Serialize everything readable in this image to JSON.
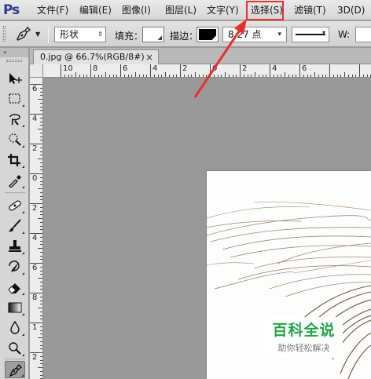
{
  "app": {
    "logo_text": "Ps",
    "menu": [
      {
        "label": "文件(F)"
      },
      {
        "label": "编辑(E)"
      },
      {
        "label": "图像(I)"
      },
      {
        "label": "图层(L)"
      },
      {
        "label": "文字(Y)"
      },
      {
        "label": "选择(S)"
      },
      {
        "label": "滤镜(T)"
      },
      {
        "label": "3D(D)"
      }
    ],
    "highlighted_menu": "选择(S)",
    "highlight_color": "#e53030"
  },
  "options_bar": {
    "tool_icon": "pen-icon",
    "mode_value": "形状",
    "fill_label": "填充：",
    "fill_color": "#ffffff",
    "stroke_label": "描边：",
    "stroke_color": "#000000",
    "stroke_width_value": "8.27 点",
    "stroke_style": "solid-line",
    "width_label": "W:"
  },
  "document": {
    "tab_title": "0.jpg @ 66.7%(RGB/8#)",
    "close_glyph": "×",
    "background_color": "#999999"
  },
  "rulers": {
    "horizontal_labels": [
      "10",
      "8",
      "6",
      "4",
      "2",
      "0",
      "2",
      "4",
      "6"
    ],
    "vertical_labels": [
      "6",
      "4",
      "2",
      "0",
      "2",
      "4",
      "6",
      "8",
      "1",
      "2"
    ]
  },
  "toolbar": {
    "collapse_glyph": "»",
    "tools": [
      {
        "name": "move-icon"
      },
      {
        "name": "marquee-icon"
      },
      {
        "name": "lasso-icon"
      },
      {
        "name": "quick-selection-icon"
      },
      {
        "name": "crop-icon"
      },
      {
        "name": "eyedropper-icon"
      },
      {
        "name": "healing-brush-icon"
      },
      {
        "name": "brush-icon"
      },
      {
        "name": "clone-stamp-icon"
      },
      {
        "name": "history-brush-icon"
      },
      {
        "name": "eraser-icon"
      },
      {
        "name": "gradient-icon"
      },
      {
        "name": "blur-icon"
      },
      {
        "name": "dodge-icon"
      },
      {
        "name": "pen-icon"
      }
    ],
    "active_tool": "pen-icon"
  },
  "watermark": {
    "title": "百科全说",
    "subtitle": "助你轻松解决",
    "color": "#22a447"
  },
  "annotation": {
    "arrow_color": "#e53030"
  }
}
